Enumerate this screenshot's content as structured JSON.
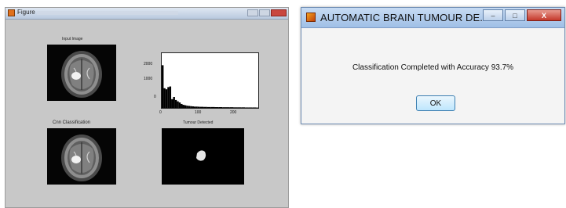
{
  "figure_window": {
    "title": "Figure",
    "input_caption": "Input Image",
    "classification_caption": "Cnn Classification",
    "tumour_caption": "Tumour Detected"
  },
  "chart_data": {
    "type": "bar",
    "title": "",
    "xlabel": "",
    "ylabel": "",
    "xlim": [
      0,
      255
    ],
    "ylim": [
      0,
      2500
    ],
    "x_ticks": [
      "0",
      "100",
      "200"
    ],
    "y_ticks": [
      "2000",
      "1000",
      "0"
    ],
    "bins": [
      0,
      5,
      10,
      15,
      20,
      25,
      30,
      35,
      40,
      45,
      50,
      55,
      60,
      65,
      70,
      75,
      80,
      85,
      90,
      95,
      100,
      110,
      120,
      130,
      140,
      150,
      160,
      170,
      180,
      190,
      200,
      210,
      220,
      230,
      240,
      250
    ],
    "values": [
      1950,
      900,
      850,
      950,
      980,
      400,
      500,
      360,
      300,
      250,
      180,
      140,
      120,
      100,
      90,
      80,
      70,
      60,
      60,
      55,
      50,
      45,
      40,
      40,
      35,
      35,
      30,
      30,
      30,
      25,
      25,
      25,
      20,
      20,
      20,
      15
    ]
  },
  "dialog": {
    "title": "AUTOMATIC BRAIN TUMOUR DE...",
    "message": "Classification Completed with Accuracy 93.7%",
    "ok_label": "OK",
    "minimize_symbol": "–",
    "maximize_symbol": "□",
    "close_symbol": "X"
  }
}
